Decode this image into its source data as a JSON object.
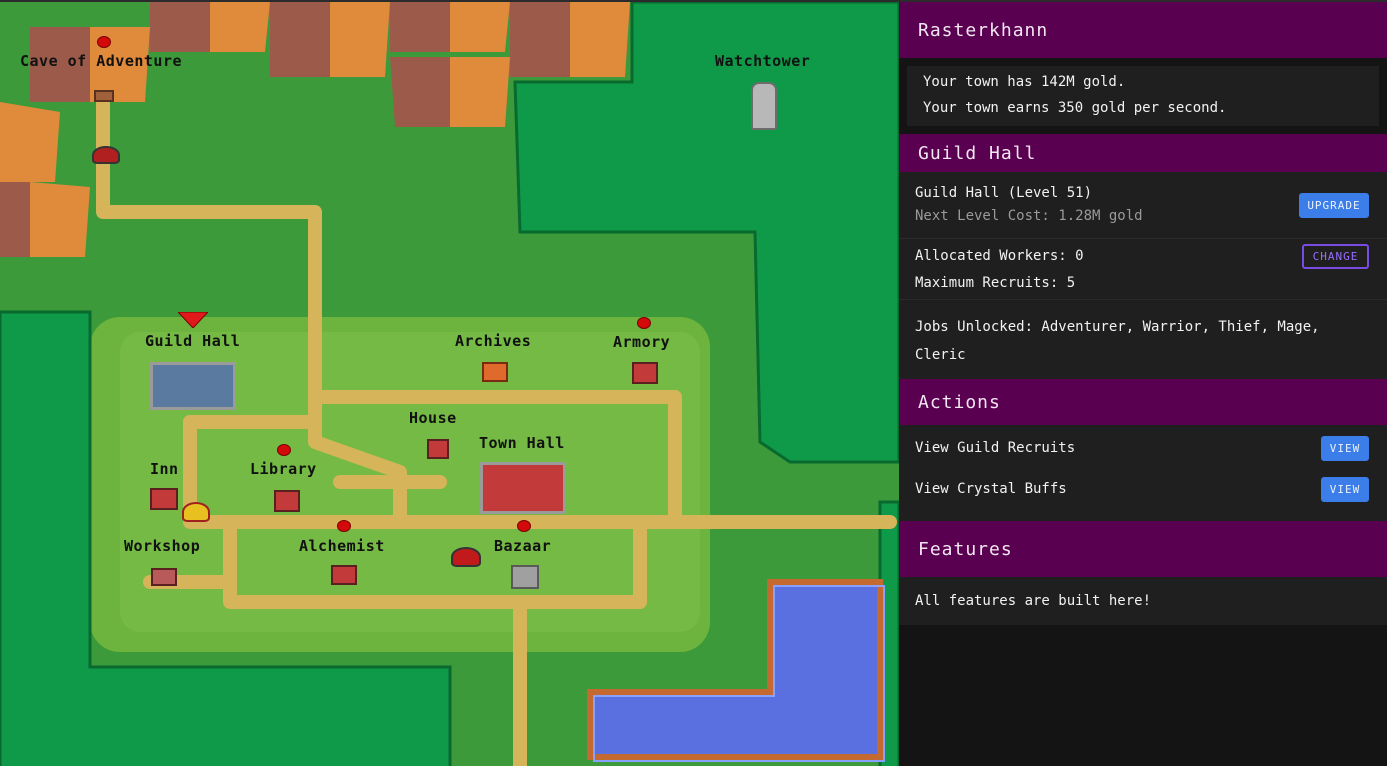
{
  "map": {
    "locations": [
      {
        "key": "cave",
        "label": "Cave of Adventure"
      },
      {
        "key": "watchtower",
        "label": "Watchtower"
      },
      {
        "key": "guild_hall",
        "label": "Guild Hall"
      },
      {
        "key": "archives",
        "label": "Archives"
      },
      {
        "key": "armory",
        "label": "Armory"
      },
      {
        "key": "house",
        "label": "House"
      },
      {
        "key": "town_hall",
        "label": "Town Hall"
      },
      {
        "key": "inn",
        "label": "Inn"
      },
      {
        "key": "library",
        "label": "Library"
      },
      {
        "key": "workshop",
        "label": "Workshop"
      },
      {
        "key": "alchemist",
        "label": "Alchemist"
      },
      {
        "key": "bazaar",
        "label": "Bazaar"
      }
    ]
  },
  "panel": {
    "town_name": "Rasterkhann",
    "gold_line": "Your town has 142M gold.",
    "earn_line": "Your town earns 350 gold per second.",
    "building": {
      "title": "Guild Hall",
      "level_text": "Guild Hall (Level 51)",
      "next_cost": "Next Level Cost: 1.28M gold",
      "upgrade_label": "UPGRADE",
      "workers": "Allocated Workers: 0",
      "change_label": "CHANGE",
      "max_recruits": "Maximum Recruits: 5",
      "jobs": "Jobs Unlocked: Adventurer, Warrior, Thief, Mage, Cleric"
    },
    "actions": {
      "title": "Actions",
      "items": [
        {
          "label": "View Guild Recruits",
          "button": "VIEW"
        },
        {
          "label": "View Crystal Buffs",
          "button": "VIEW"
        }
      ]
    },
    "features": {
      "title": "Features",
      "text": "All features are built here!"
    }
  },
  "colors": {
    "header": "#5a0050",
    "button_blue": "#3b7de9",
    "button_outline": "#7a4be0",
    "grass": "#3c9a3a",
    "path": "#d6b45a",
    "water": "#5a6fe0"
  }
}
